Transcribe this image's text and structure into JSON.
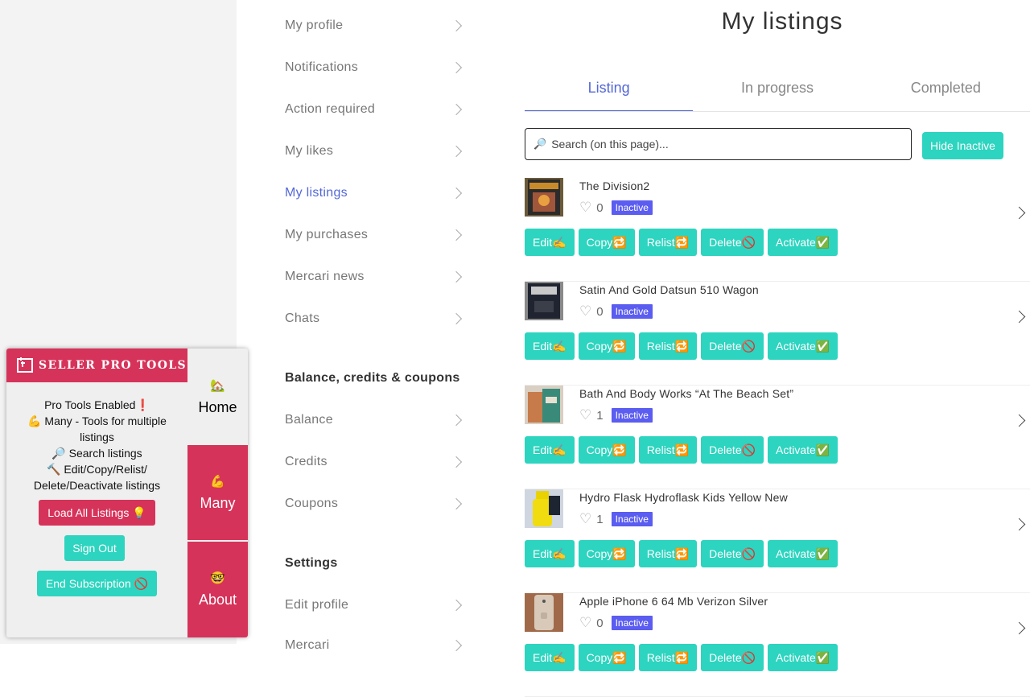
{
  "nav": {
    "items": [
      {
        "label": "My profile",
        "active": false
      },
      {
        "label": "Notifications",
        "active": false
      },
      {
        "label": "Action required",
        "active": false
      },
      {
        "label": "My likes",
        "active": false
      },
      {
        "label": "My listings",
        "active": true
      },
      {
        "label": "My purchases",
        "active": false
      },
      {
        "label": "Mercari news",
        "active": false
      },
      {
        "label": "Chats",
        "active": false
      }
    ],
    "balance_heading": "Balance, credits & coupons",
    "balance_items": [
      {
        "label": "Balance"
      },
      {
        "label": "Credits"
      },
      {
        "label": "Coupons"
      }
    ],
    "settings_heading": "Settings",
    "settings_items": [
      {
        "label": "Edit profile"
      },
      {
        "label": "Mercari"
      }
    ]
  },
  "main": {
    "title": "My listings",
    "tabs": [
      "Listing",
      "In progress",
      "Completed"
    ],
    "active_tab": 0,
    "search_placeholder": "Search (on this page)...",
    "hide_inactive_label": "Hide Inactive"
  },
  "listings": [
    {
      "title": "The Division2",
      "likes": "0",
      "status": "Inactive",
      "thumb": "game-cover"
    },
    {
      "title": "Satin And Gold Datsun 510 Wagon",
      "likes": "0",
      "status": "Inactive",
      "thumb": "toy-car-package"
    },
    {
      "title": "Bath And Body Works “At The Beach Set”",
      "likes": "1",
      "status": "Inactive",
      "thumb": "bath-products"
    },
    {
      "title": "Hydro Flask Hydroflask Kids Yellow New",
      "likes": "1",
      "status": "Inactive",
      "thumb": "yellow-bottle"
    },
    {
      "title": "Apple iPhone 6 64 Mb Verizon Silver",
      "likes": "0",
      "status": "Inactive",
      "thumb": "phone"
    }
  ],
  "actions": {
    "edit": "Edit✍️",
    "copy": "Copy🔁",
    "relist": "Relist🔁",
    "delete": "Delete🚫",
    "activate": "Activate✅"
  },
  "popup": {
    "brand": "SELLER PRO TOOLS",
    "lines": [
      "Pro Tools Enabled❗",
      "💪 Many - Tools for multiple listings",
      "🔎 Search listings",
      "🔨 Edit/Copy/Relist/",
      "Delete/Deactivate listings"
    ],
    "load_all": "Load All Listings 💡",
    "sign_out": "Sign Out",
    "end_sub": "End Subscription 🚫",
    "side": {
      "home_emoji": "🏡",
      "home": "Home",
      "many_emoji": "💪",
      "many": "Many",
      "about_emoji": "🤓",
      "about": "About"
    }
  },
  "colors": {
    "accent": "#5468d6",
    "teal": "#2dd4bf",
    "pink": "#d6335a",
    "badge": "#5b5cf0"
  }
}
